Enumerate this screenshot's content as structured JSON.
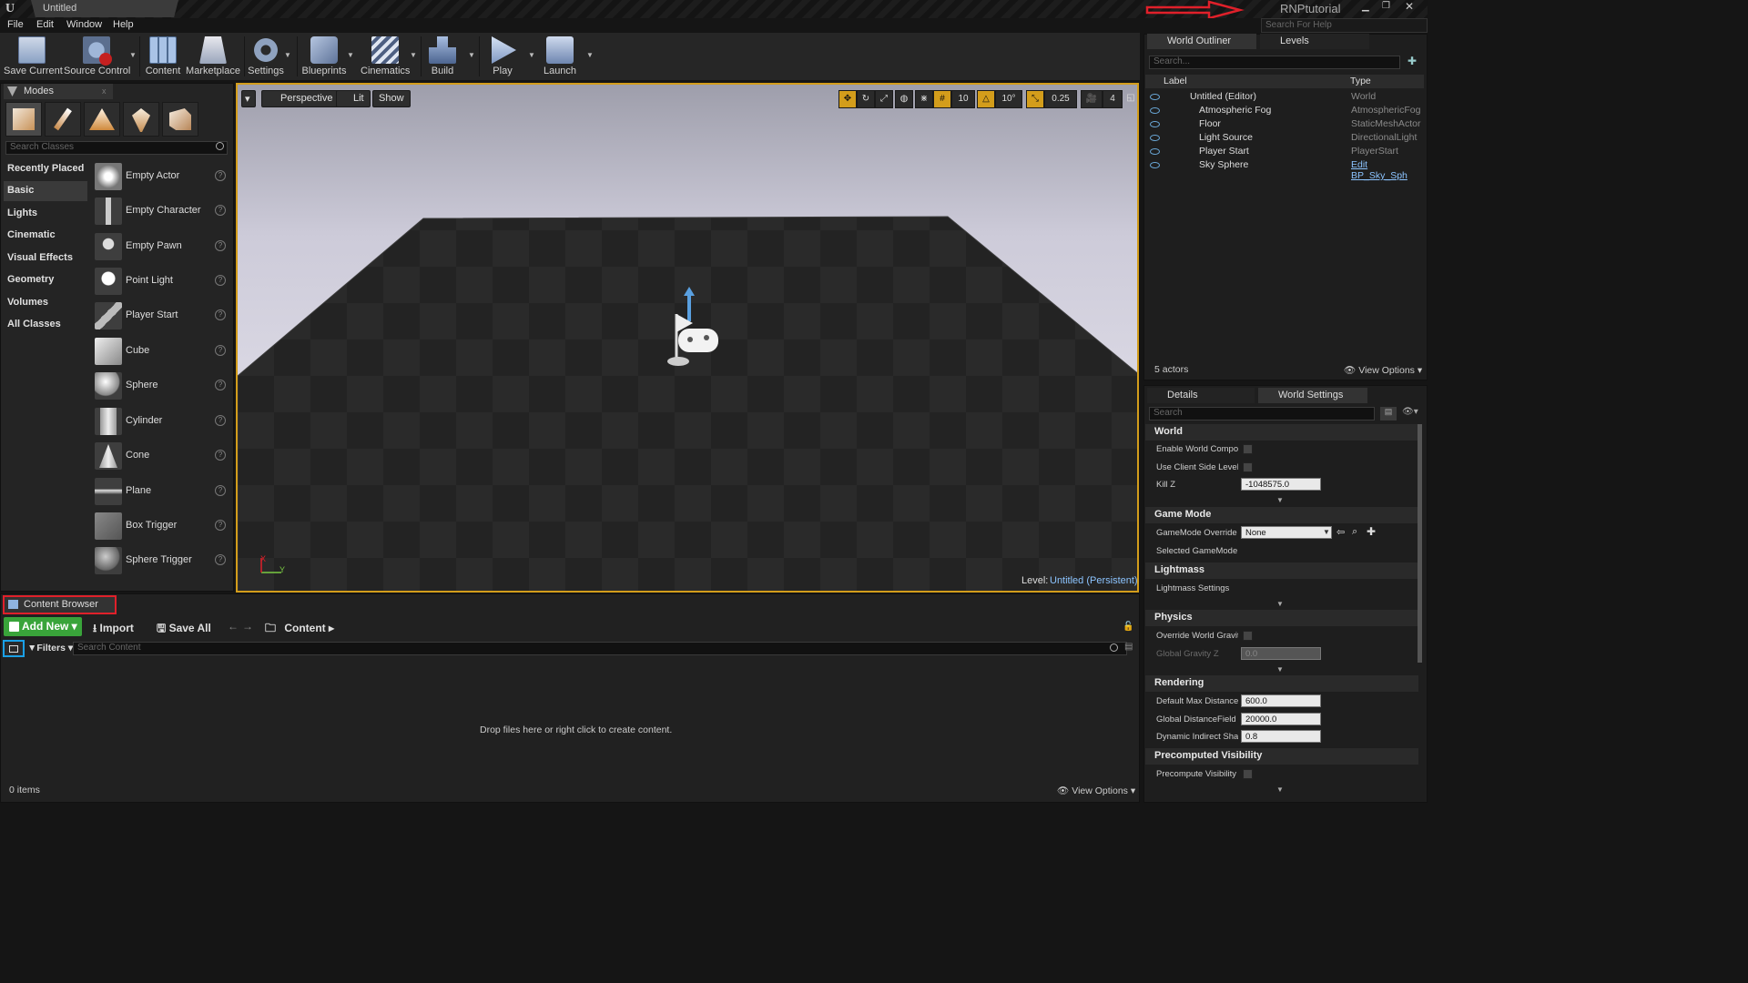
{
  "titlebar": {
    "tab": "Untitled",
    "brand": "RNPtutorial",
    "help_search_placeholder": "Search For Help"
  },
  "menu": [
    "File",
    "Edit",
    "Window",
    "Help"
  ],
  "toolbar": [
    {
      "label": "Save Current",
      "icon": "save-icon"
    },
    {
      "label": "Source Control",
      "icon": "source-control-icon"
    },
    {
      "label": "Content",
      "icon": "content-icon"
    },
    {
      "label": "Marketplace",
      "icon": "marketplace-icon"
    },
    {
      "label": "Settings",
      "icon": "settings-icon"
    },
    {
      "label": "Blueprints",
      "icon": "blueprints-icon"
    },
    {
      "label": "Cinematics",
      "icon": "cinematics-icon"
    },
    {
      "label": "Build",
      "icon": "build-icon"
    },
    {
      "label": "Play",
      "icon": "play-icon"
    },
    {
      "label": "Launch",
      "icon": "launch-icon"
    }
  ],
  "modes": {
    "tab": "Modes",
    "search_placeholder": "Search Classes",
    "categories": [
      "Recently Placed",
      "Basic",
      "Lights",
      "Cinematic",
      "Visual Effects",
      "Geometry",
      "Volumes",
      "All Classes"
    ],
    "selected_category": "Basic",
    "items": [
      "Empty Actor",
      "Empty Character",
      "Empty Pawn",
      "Point Light",
      "Player Start",
      "Cube",
      "Sphere",
      "Cylinder",
      "Cone",
      "Plane",
      "Box Trigger",
      "Sphere Trigger"
    ]
  },
  "viewport": {
    "perspective": "Perspective",
    "lit": "Lit",
    "show": "Show",
    "grid_snap": "10",
    "rotation_snap": "10°",
    "scale_snap": "0.25",
    "camera_speed": "4",
    "level_label": "Level:",
    "level_name": "Untitled (Persistent)",
    "axis_x": "X",
    "axis_y": "Y"
  },
  "outliner": {
    "tab": "World Outliner",
    "levels_tab": "Levels",
    "search_placeholder": "Search...",
    "col_label": "Label",
    "col_type": "Type",
    "rows": [
      {
        "label": "Untitled (Editor)",
        "type": "World"
      },
      {
        "label": "Atmospheric Fog",
        "type": "AtmosphericFog"
      },
      {
        "label": "Floor",
        "type": "StaticMeshActor"
      },
      {
        "label": "Light Source",
        "type": "DirectionalLight"
      },
      {
        "label": "Player Start",
        "type": "PlayerStart"
      },
      {
        "label": "Sky Sphere",
        "type": "Edit BP_Sky_Sph"
      }
    ],
    "actor_count": "5 actors",
    "view_options": "View Options"
  },
  "details": {
    "tab": "Details",
    "world_settings_tab": "World Settings",
    "search_placeholder": "Search",
    "sections": {
      "world": "World",
      "game_mode": "Game Mode",
      "lightmass": "Lightmass",
      "physics": "Physics",
      "rendering": "Rendering",
      "precomputed": "Precomputed Visibility"
    },
    "props": {
      "enable_world_comp": "Enable World Compos",
      "use_client_side": "Use Client Side Level",
      "kill_z": "Kill Z",
      "kill_z_value": "-1048575.0",
      "gamemode_override": "GameMode Override",
      "gamemode_value": "None",
      "selected_gamemode": "Selected GameMode",
      "lightmass_settings": "Lightmass Settings",
      "override_gravity": "Override World Gravity",
      "global_gravity": "Global Gravity Z",
      "global_gravity_value": "0.0",
      "default_max_distance": "Default Max Distance",
      "default_max_distance_value": "600.0",
      "global_distance_field": "Global DistanceField V",
      "global_distance_field_value": "20000.0",
      "dynamic_indirect": "Dynamic Indirect Sha",
      "dynamic_indirect_value": "0.8",
      "precompute_visibility": "Precompute Visibility"
    }
  },
  "content_browser": {
    "tab": "Content Browser",
    "add_new": "Add New",
    "import": "Import",
    "save_all": "Save All",
    "path": "Content",
    "filters": "Filters",
    "search_placeholder": "Search Content",
    "empty_text": "Drop files here or right click to create content.",
    "items_count": "0 items",
    "view_options": "View Options"
  },
  "colors": {
    "accent_orange": "#d39d1b",
    "add_new_green": "#39a43a",
    "highlight_red": "#e0202a",
    "highlight_blue": "#1aa0e6"
  }
}
